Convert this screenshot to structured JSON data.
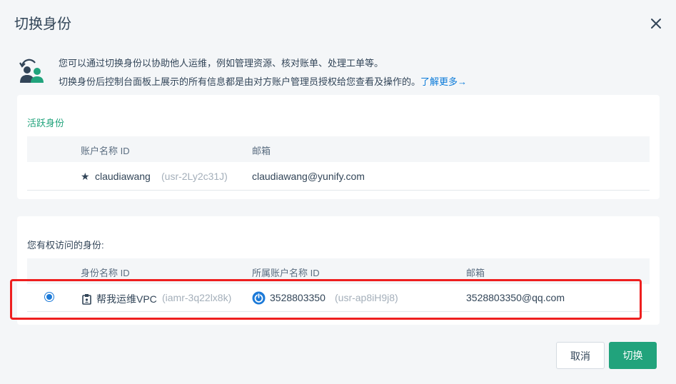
{
  "dialog": {
    "title": "切换身份",
    "close_icon": "close-icon"
  },
  "intro": {
    "icon": "switch-user-icon",
    "line1": "您可以通过切换身份以协助他人运维，例如管理资源、核对账单、处理工单等。",
    "line2": "切换身份后控制台面板上展示的所有信息都是由对方账户管理员授权给您查看及操作的。",
    "learn_more": "了解更多→"
  },
  "active_identity": {
    "title": "活跃身份",
    "columns": [
      "账户名称 ID",
      "邮箱"
    ],
    "rows": [
      {
        "star": "★",
        "name": "claudiawang",
        "id": "(usr-2Ly2c31J)",
        "email": "claudiawang@yunify.com"
      }
    ]
  },
  "accessible_identities": {
    "title": "您有权访问的身份:",
    "columns": [
      "身份名称 ID",
      "所属账户名称 ID",
      "邮箱"
    ],
    "rows": [
      {
        "selected": true,
        "identity_icon": "badge-icon",
        "identity_name": "帮我运维VPC",
        "identity_id": "(iamr-3q22lx8k)",
        "account_icon": "power-icon",
        "account_name": "3528803350",
        "account_id": "(usr-ap8iH9j8)",
        "email": "3528803350@qq.com"
      }
    ]
  },
  "footer": {
    "cancel_label": "取消",
    "switch_label": "切换"
  },
  "colors": {
    "accent_green": "#21a37c",
    "link_blue": "#0a7ad9",
    "highlight_red": "#ee1f1f"
  }
}
